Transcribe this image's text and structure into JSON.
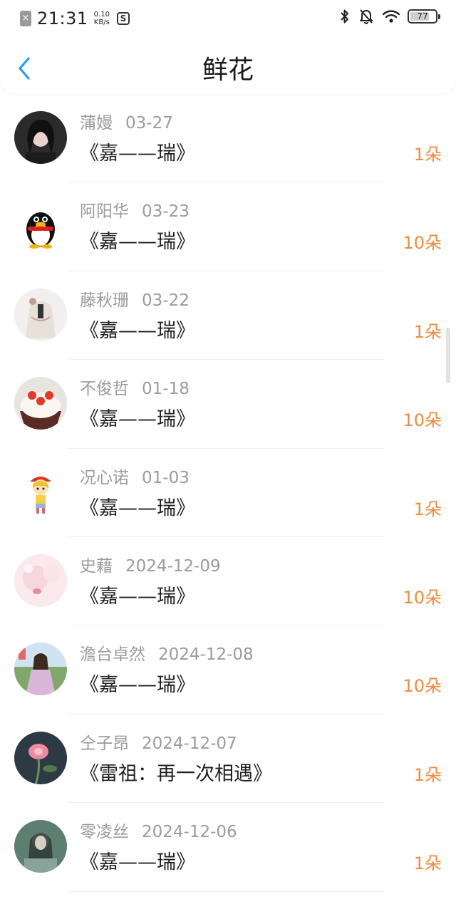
{
  "status_bar": {
    "close_mark": "×",
    "time": "21:31",
    "speed_value": "0.10",
    "speed_unit": "KB/s",
    "app_mark": "S",
    "battery": "77",
    "battery_level": 0.77
  },
  "header": {
    "title": "鲜花"
  },
  "flowers": [
    {
      "name": "蒲嫚",
      "date": "03-27",
      "title": "《嘉——瑞》",
      "amount": "1朵"
    },
    {
      "name": "阿阳华",
      "date": "03-23",
      "title": "《嘉——瑞》",
      "amount": "10朵"
    },
    {
      "name": "藤秋珊",
      "date": "03-22",
      "title": "《嘉——瑞》",
      "amount": "1朵"
    },
    {
      "name": "不俊哲",
      "date": "01-18",
      "title": "《嘉——瑞》",
      "amount": "10朵"
    },
    {
      "name": "况心诺",
      "date": "01-03",
      "title": "《嘉——瑞》",
      "amount": "1朵"
    },
    {
      "name": "史藉",
      "date": "2024-12-09",
      "title": "《嘉——瑞》",
      "amount": "10朵"
    },
    {
      "name": "澹台卓然",
      "date": "2024-12-08",
      "title": "《嘉——瑞》",
      "amount": "10朵"
    },
    {
      "name": "仝子昂",
      "date": "2024-12-07",
      "title": "《雷祖：再一次相遇》",
      "amount": "1朵"
    },
    {
      "name": "零凌丝",
      "date": "2024-12-06",
      "title": "《嘉——瑞》",
      "amount": "1朵"
    }
  ],
  "colors": {
    "accent_blue": "#2d9cf0",
    "amount_orange": "#f08a3c",
    "meta_gray": "#9b9b9b"
  }
}
